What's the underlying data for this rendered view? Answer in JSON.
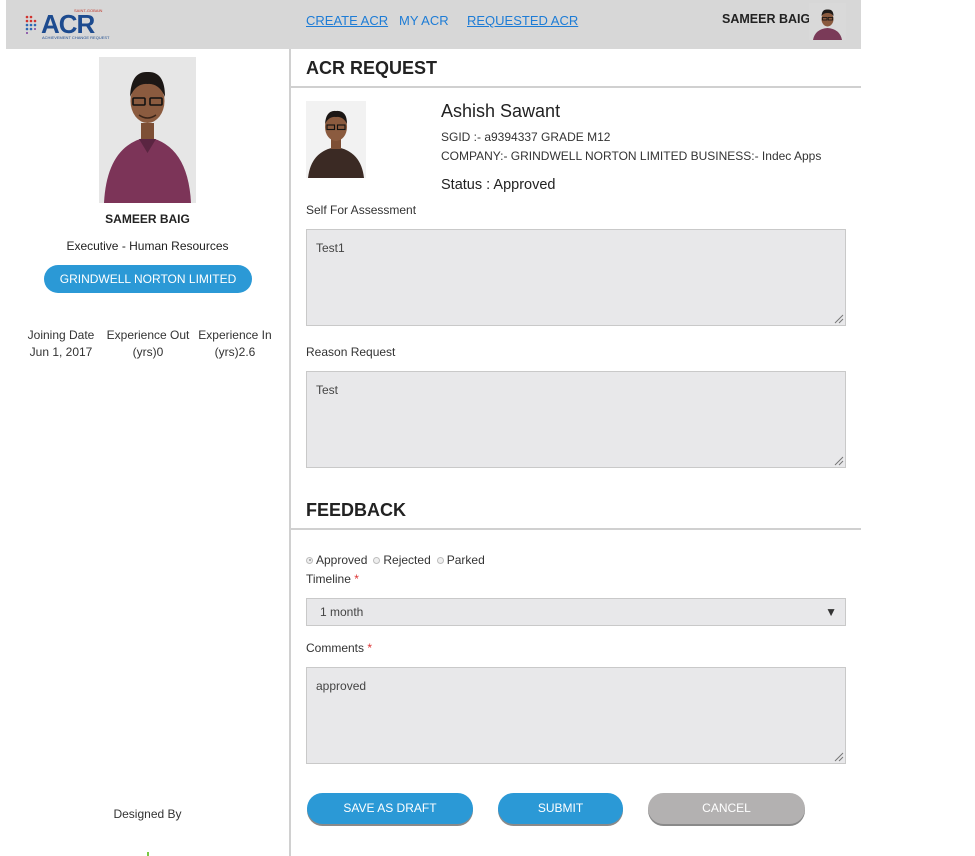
{
  "header": {
    "logo_text": "ACR",
    "logo_tagline": "ACHIEVEMENT CHANGE REQUEST",
    "logo_spark": "SAINT-GOBAIN",
    "nav": [
      "CREATE ACR",
      "MY ACR",
      "REQUESTED ACR"
    ],
    "user_name": "SAMEER BAIG"
  },
  "sidebar": {
    "name": "SAMEER BAIG",
    "role": "Executive - Human Resources",
    "company": "GRINDWELL NORTON LIMITED",
    "stats": [
      {
        "line1": "Joining Date",
        "line2": "Jun 1, 2017"
      },
      {
        "line1": "Experience Out",
        "line2": "(yrs)0"
      },
      {
        "line1": "Experience In",
        "line2": "(yrs)2.6"
      }
    ],
    "designed_by": "Designed By"
  },
  "request": {
    "title": "ACR REQUEST",
    "employee_name": "Ashish Sawant",
    "sgid_line": "SGID :- a9394337 GRADE M12",
    "company_line": "COMPANY:- GRINDWELL NORTON LIMITED BUSINESS:- Indec Apps",
    "status_line": "Status : Approved",
    "self_assessment_label": "Self For Assessment",
    "self_assessment_value": "Test1",
    "reason_label": "Reason Request",
    "reason_value": "Test"
  },
  "feedback": {
    "title": "FEEDBACK",
    "options": [
      "Approved",
      "Rejected",
      "Parked"
    ],
    "selected": "Approved",
    "timeline_label": "Timeline",
    "required_mark": "*",
    "timeline_value": "1 month",
    "dropdown_arrow": "▼",
    "comments_label": "Comments",
    "comments_value": "approved"
  },
  "buttons": {
    "save_draft": "SAVE AS DRAFT",
    "submit": "SUBMIT",
    "cancel": "CANCEL"
  },
  "colors": {
    "header_bg": "#d7d7d7",
    "link": "#1d7cd6",
    "primary_button": "#2b99d6",
    "cancel_button": "#b3b1b1",
    "field_bg": "#e8e8ea"
  }
}
